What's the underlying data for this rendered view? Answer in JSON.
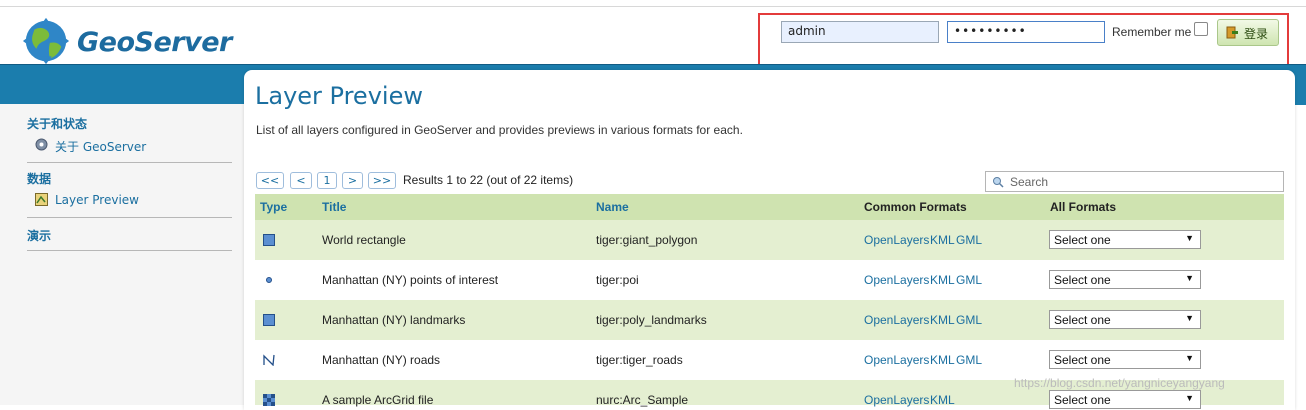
{
  "header": {
    "logo_text": "GeoServer",
    "username_value": "admin",
    "password_value": "•••••••••",
    "remember_label": "Remember me",
    "login_label": "登录"
  },
  "sidebar": {
    "sections": [
      {
        "label": "关于和状态",
        "items": [
          {
            "label": "关于 GeoServer",
            "icon": "info-icon"
          }
        ]
      },
      {
        "label": "数据",
        "items": [
          {
            "label": "Layer Preview",
            "icon": "map-icon"
          }
        ]
      },
      {
        "label": "演示",
        "items": []
      }
    ]
  },
  "main": {
    "title": "Layer Preview",
    "description": "List of all layers configured in GeoServer and provides previews in various formats for each.",
    "pager": {
      "first": "<<",
      "prev": "<",
      "page": "1",
      "next": ">",
      "last": ">>",
      "results": "Results 1 to 22 (out of 22 items)"
    },
    "search_placeholder": "Search",
    "columns": [
      "Type",
      "Title",
      "Name",
      "Common Formats",
      "All Formats"
    ],
    "rows": [
      {
        "type": "polygon-icon",
        "title": "World rectangle",
        "name": "tiger:giant_polygon",
        "formats": [
          "OpenLayers",
          "KML",
          "GML"
        ],
        "select": "Select one"
      },
      {
        "type": "point-icon",
        "title": "Manhattan (NY) points of interest",
        "name": "tiger:poi",
        "formats": [
          "OpenLayers",
          "KML",
          "GML"
        ],
        "select": "Select one"
      },
      {
        "type": "polygon-icon",
        "title": "Manhattan (NY) landmarks",
        "name": "tiger:poly_landmarks",
        "formats": [
          "OpenLayers",
          "KML",
          "GML"
        ],
        "select": "Select one"
      },
      {
        "type": "line-icon",
        "title": "Manhattan (NY) roads",
        "name": "tiger:tiger_roads",
        "formats": [
          "OpenLayers",
          "KML",
          "GML"
        ],
        "select": "Select one"
      },
      {
        "type": "raster-icon",
        "title": "A sample ArcGrid file",
        "name": "nurc:Arc_Sample",
        "formats": [
          "OpenLayers",
          "KML"
        ],
        "select": "Select one"
      }
    ]
  },
  "watermark": "https://blog.csdn.net/yangniceyangyang",
  "colors": {
    "brand_blue": "#1b7dad",
    "link_blue": "#1b6fa0",
    "row_green": "#e4efd1",
    "header_green": "#cfe3b0",
    "highlight_red": "#e33b3b"
  }
}
